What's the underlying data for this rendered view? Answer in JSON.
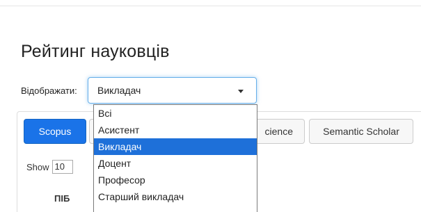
{
  "page": {
    "title": "Рейтинг науковців"
  },
  "display": {
    "label": "Відображати:",
    "selected": "Викладач",
    "options": [
      "Всі",
      "Асистент",
      "Викладач",
      "Доцент",
      "Професор",
      "Старший викладач"
    ],
    "selected_index": 2
  },
  "tabs": [
    {
      "label": "Scopus",
      "active": true
    },
    {
      "label": "",
      "active": false
    },
    {
      "label": "cience",
      "active": false
    },
    {
      "label": "Semantic Scholar",
      "active": false
    }
  ],
  "table": {
    "show_label": "Show",
    "page_size": "10",
    "column_header": "ПІБ"
  },
  "colors": {
    "accent": "#1a73e8",
    "selection": "#1e70d9",
    "focus": "#66afe9"
  }
}
